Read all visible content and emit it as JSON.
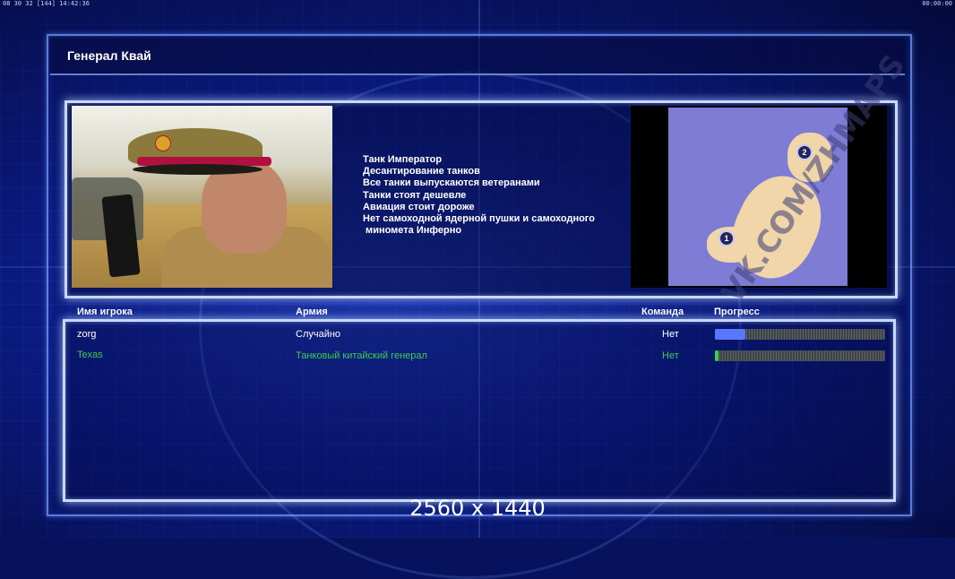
{
  "hud": {
    "top_left": "08 30 32 [144] 14:42:36",
    "top_right": "00:00:00"
  },
  "window": {
    "title": "Генерал Квай"
  },
  "general": {
    "portrait_icon": "general-portrait",
    "bio_lines": [
      "Танк Император",
      "Десантирование танков",
      "Все танки выпускаются ветеранами",
      "Танки стоят дешевле",
      "Авиация стоит дороже",
      "Нет самоходной ядерной пушки и самоходного",
      " минометa Инферно"
    ]
  },
  "minimap": {
    "watermark": "VK.COM/ZHMAPS",
    "markers": [
      "1",
      "2"
    ]
  },
  "columns": {
    "player": "Имя игрока",
    "army": "Армия",
    "team": "Команда",
    "progress": "Прогресс"
  },
  "players": [
    {
      "name": "zorg",
      "army": "Случайно",
      "team": "Нет",
      "progress": 0.18,
      "color": "#ffffff",
      "bar_color": "#5a78ff"
    },
    {
      "name": "Texas",
      "army": "Танковый китайский генерал",
      "team": "Нет",
      "progress": 0.02,
      "color": "#39d04a",
      "bar_color": "#39d04a"
    }
  ],
  "footer": {
    "resolution": "2560 x 1440"
  }
}
